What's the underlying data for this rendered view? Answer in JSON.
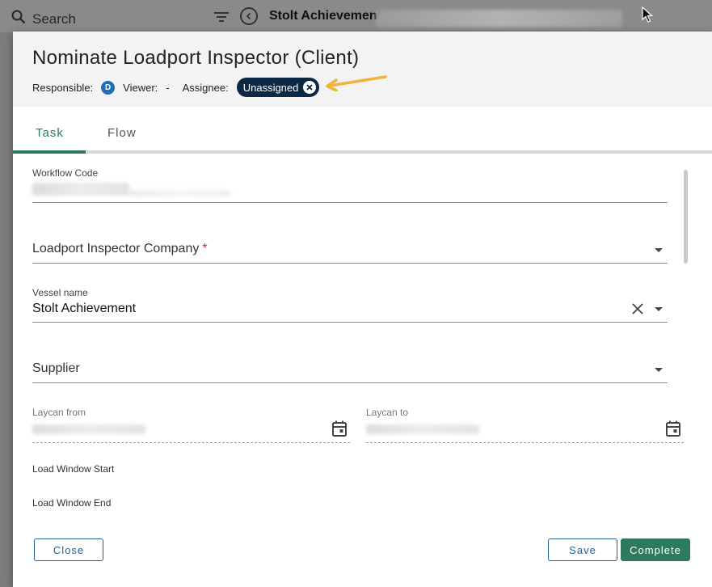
{
  "background": {
    "search_label": "Search",
    "vessel_title": "Stolt Achievement"
  },
  "modal": {
    "title": "Nominate Loadport Inspector (Client)",
    "responsible_label": "Responsible:",
    "responsible_avatar": "D",
    "viewer_label": "Viewer:",
    "viewer_value": "-",
    "assignee_label": "Assignee:",
    "assignee_chip": "Unassigned"
  },
  "tabs": [
    {
      "label": "Task",
      "active": true
    },
    {
      "label": "Flow",
      "active": false
    }
  ],
  "form": {
    "workflow_code_label": "Workflow Code",
    "loadport_inspector_label": "Loadport Inspector Company",
    "required_marker": "*",
    "vessel_name_label": "Vessel name",
    "vessel_name_value": "Stolt Achievement",
    "supplier_label": "Supplier",
    "laycan_from_label": "Laycan from",
    "laycan_to_label": "Laycan to",
    "load_window_start_label": "Load Window Start",
    "load_window_end_label": "Load Window End"
  },
  "buttons": {
    "close": "Close",
    "save": "Save",
    "complete": "Complete"
  },
  "colors": {
    "accent_green": "#2e7a5c",
    "chip_navy": "#0c2844",
    "outline_blue": "#1f5f9a",
    "annotation_arrow": "#f2b33d"
  }
}
